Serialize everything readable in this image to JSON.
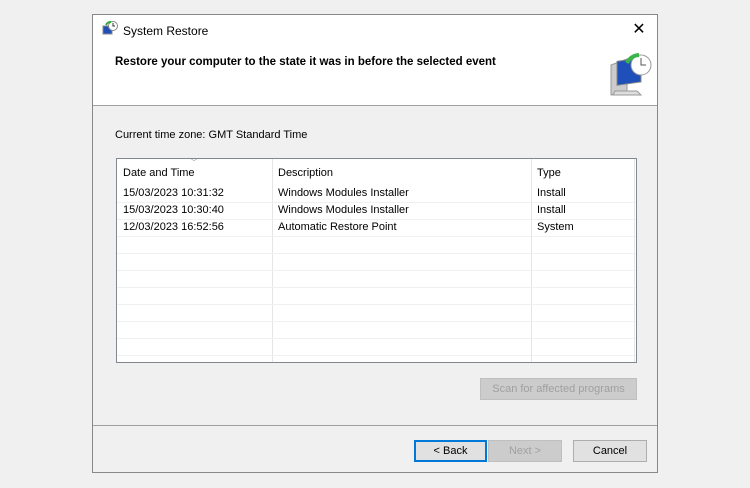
{
  "window": {
    "title": "System Restore",
    "close": "✕"
  },
  "header": {
    "heading": "Restore your computer to the state it was in before the selected event"
  },
  "timezone": "Current time zone: GMT Standard Time",
  "table": {
    "columns": [
      "Date and Time",
      "Description",
      "Type"
    ],
    "rows": [
      [
        "15/03/2023 10:31:32",
        "Windows Modules Installer",
        "Install"
      ],
      [
        "15/03/2023 10:30:40",
        "Windows Modules Installer",
        "Install"
      ],
      [
        "12/03/2023 16:52:56",
        "Automatic Restore Point",
        "System"
      ]
    ]
  },
  "buttons": {
    "scan": "Scan for affected programs",
    "back": "< Back",
    "next": "Next >",
    "cancel": "Cancel"
  }
}
